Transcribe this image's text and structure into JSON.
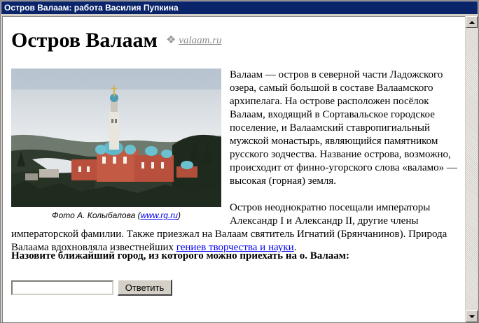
{
  "window": {
    "title": "Остров Валаам: работа Василия Пупкина"
  },
  "page": {
    "heading": "Остров Валаам",
    "site_link": {
      "icon": "ornament-icon",
      "glyph": "❖",
      "text": "valaam.ru"
    }
  },
  "photo": {
    "caption_prefix": "Фото А. Колыбалова (",
    "caption_link": "www.rg.ru",
    "caption_suffix": ")"
  },
  "article": {
    "paragraph1": "Валаам — остров в северной части Ладожского озера, самый большой в составе Валаамского архипелага. На острове расположен посёлок Валаам, входящий в Сортавальское городское поселение, и Валаамский ставропигиальный мужской монастырь, являющийся памятником русского зодчества. Название острова, возможно, происходит от финно-угорского слова «валамо» — высокая (горная) земля.",
    "paragraph2_text": "Остров неоднократно посещали императоры Александр I и Александр II, другие члены императорской фамилии. Также приезжал на Валаам святитель Игнатий (Брянчанинов). Природа Валаама вдохновляла известнейших ",
    "paragraph2_link": "гениев творчества и науки",
    "paragraph2_end": "."
  },
  "quiz": {
    "question": "Назовите ближайший город, из которого можно приехать на о. Валаам:",
    "input_value": "",
    "button_label": "Ответить"
  },
  "colors": {
    "titlebar": "#0a246a",
    "link": "#0000ee",
    "site_link": "#8a8a8a"
  }
}
